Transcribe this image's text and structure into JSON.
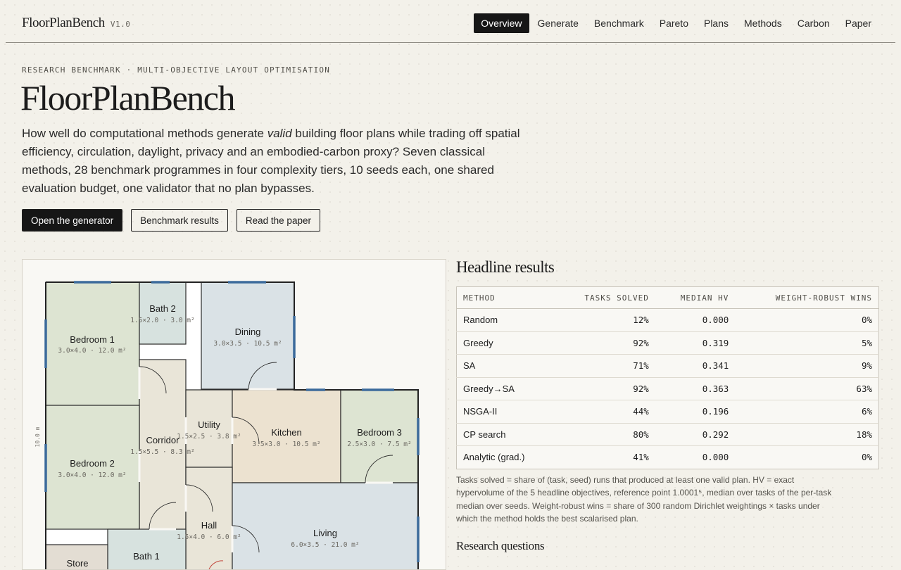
{
  "brand": {
    "name": "FloorPlanBench",
    "version": "V1.0"
  },
  "nav": [
    {
      "label": "Overview",
      "active": true
    },
    {
      "label": "Generate"
    },
    {
      "label": "Benchmark"
    },
    {
      "label": "Pareto"
    },
    {
      "label": "Plans"
    },
    {
      "label": "Methods"
    },
    {
      "label": "Carbon"
    },
    {
      "label": "Paper"
    }
  ],
  "hero": {
    "eyebrow": "RESEARCH BENCHMARK · MULTI-OBJECTIVE LAYOUT OPTIMISATION",
    "title": "FloorPlanBench",
    "lede_before": "How well do computational methods generate ",
    "lede_em": "valid",
    "lede_after": " building floor plans while trading off spatial efficiency, circulation, daylight, privacy and an embodied-carbon proxy? Seven classical methods, 28 benchmark programmes in four complexity tiers, 10 seeds each, one shared evaluation budget, one validator that no plan bypasses.",
    "buttons": {
      "generator": "Open the generator",
      "benchmark": "Benchmark results",
      "paper": "Read the paper"
    }
  },
  "plan": {
    "dimension_label": "10.0 m",
    "rooms": [
      {
        "name": "Bedroom 1",
        "dims": "3.0×4.0 · 12.0 m²"
      },
      {
        "name": "Bath 2",
        "dims": "1.5×2.0 · 3.0 m²"
      },
      {
        "name": "Dining",
        "dims": "3.0×3.5 · 10.5 m²"
      },
      {
        "name": "Corridor",
        "dims": "1.5×5.5 · 8.3 m²"
      },
      {
        "name": "Utility",
        "dims": "1.5×2.5 · 3.8 m²"
      },
      {
        "name": "Kitchen",
        "dims": "3.5×3.0 · 10.5 m²"
      },
      {
        "name": "Bedroom 3",
        "dims": "2.5×3.0 · 7.5 m²"
      },
      {
        "name": "Bedroom 2",
        "dims": "3.0×4.0 · 12.0 m²"
      },
      {
        "name": "Hall",
        "dims": "1.5×4.0 · 6.0 m²"
      },
      {
        "name": "Living",
        "dims": "6.0×3.5 · 21.0 m²"
      },
      {
        "name": "Bath 1",
        "dims": ""
      },
      {
        "name": "Store",
        "dims": ""
      }
    ]
  },
  "results": {
    "title": "Headline results",
    "columns": [
      "METHOD",
      "TASKS SOLVED",
      "MEDIAN HV",
      "WEIGHT-ROBUST WINS"
    ],
    "rows": [
      [
        "Random",
        "12%",
        "0.000",
        "0%"
      ],
      [
        "Greedy",
        "92%",
        "0.319",
        "5%"
      ],
      [
        "SA",
        "71%",
        "0.341",
        "9%"
      ],
      [
        "Greedy→SA",
        "92%",
        "0.363",
        "63%"
      ],
      [
        "NSGA-II",
        "44%",
        "0.196",
        "6%"
      ],
      [
        "CP search",
        "80%",
        "0.292",
        "18%"
      ],
      [
        "Analytic (grad.)",
        "41%",
        "0.000",
        "0%"
      ]
    ],
    "footnote": "Tasks solved = share of (task, seed) runs that produced at least one valid plan. HV = exact hypervolume of the 5 headline objectives, reference point 1.0001⁵, median over tasks of the per-task median over seeds. Weight-robust wins = share of 300 random Dirichlet weightings × tasks under which the method holds the best scalarised plan."
  },
  "research": {
    "title": "Research questions"
  },
  "colors": {
    "accent_dark": "#161616",
    "bedroom": "#dde4d2",
    "bath": "#d7e2df",
    "dining_living": "#dae2e6",
    "circulation": "#e9e5d8",
    "kitchen": "#ece2d0",
    "window": "#3b6a9b"
  }
}
